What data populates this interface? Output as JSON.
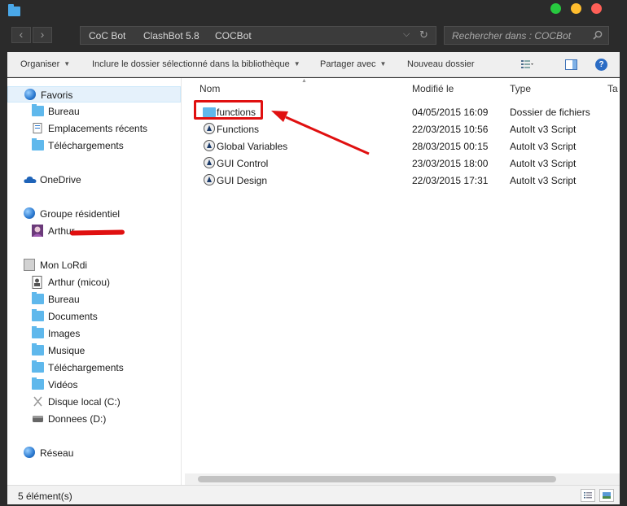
{
  "window": {
    "controls": [
      "maximize",
      "minimize",
      "close"
    ]
  },
  "address": {
    "crumbs": [
      "CoC Bot",
      "ClashBot 5.8",
      "COCBot"
    ],
    "search_placeholder": "Rechercher dans : COCBot"
  },
  "commands": {
    "organize": "Organiser",
    "include": "Inclure le dossier sélectionné dans la bibliothèque",
    "share": "Partager avec",
    "new_folder": "Nouveau dossier"
  },
  "sidebar": {
    "favorites": {
      "label": "Favoris",
      "items": [
        {
          "label": "Bureau",
          "icon": "folder-icon"
        },
        {
          "label": "Emplacements récents",
          "icon": "recent-places-icon"
        },
        {
          "label": "Téléchargements",
          "icon": "folder-icon"
        }
      ]
    },
    "onedrive": {
      "label": "OneDrive"
    },
    "homegroup": {
      "label": "Groupe résidentiel",
      "items": [
        {
          "label": "Arthur",
          "icon": "user-avatar-icon"
        }
      ]
    },
    "computer": {
      "label": "Mon LoRdi",
      "items": [
        {
          "label": "Arthur (micou)",
          "icon": "user-folder-icon"
        },
        {
          "label": "Bureau",
          "icon": "folder-icon"
        },
        {
          "label": "Documents",
          "icon": "folder-icon"
        },
        {
          "label": "Images",
          "icon": "folder-icon"
        },
        {
          "label": "Musique",
          "icon": "folder-icon"
        },
        {
          "label": "Téléchargements",
          "icon": "folder-icon"
        },
        {
          "label": "Vidéos",
          "icon": "folder-icon"
        },
        {
          "label": "Disque local (C:)",
          "icon": "drive-icon"
        },
        {
          "label": "Donnees (D:)",
          "icon": "drive-icon"
        }
      ]
    },
    "network": {
      "label": "Réseau"
    }
  },
  "files": {
    "columns": [
      "Nom",
      "Modifié le",
      "Type",
      "Ta"
    ],
    "rows": [
      {
        "name": "functions",
        "modified": "04/05/2015 16:09",
        "type": "Dossier de fichiers",
        "icon": "folder-icon"
      },
      {
        "name": "Functions",
        "modified": "22/03/2015 10:56",
        "type": "AutoIt v3 Script",
        "icon": "autoit-script-icon"
      },
      {
        "name": "Global Variables",
        "modified": "28/03/2015 00:15",
        "type": "AutoIt v3 Script",
        "icon": "autoit-script-icon"
      },
      {
        "name": "GUI Control",
        "modified": "23/03/2015 18:00",
        "type": "AutoIt v3 Script",
        "icon": "autoit-script-icon"
      },
      {
        "name": "GUI Design",
        "modified": "22/03/2015 17:31",
        "type": "AutoIt v3 Script",
        "icon": "autoit-script-icon"
      }
    ]
  },
  "status": {
    "count_text": "5 élément(s)"
  },
  "colors": {
    "annotation_red": "#e01010",
    "folder_blue": "#5fb8ec",
    "chrome_dark": "#2b2b2b"
  }
}
